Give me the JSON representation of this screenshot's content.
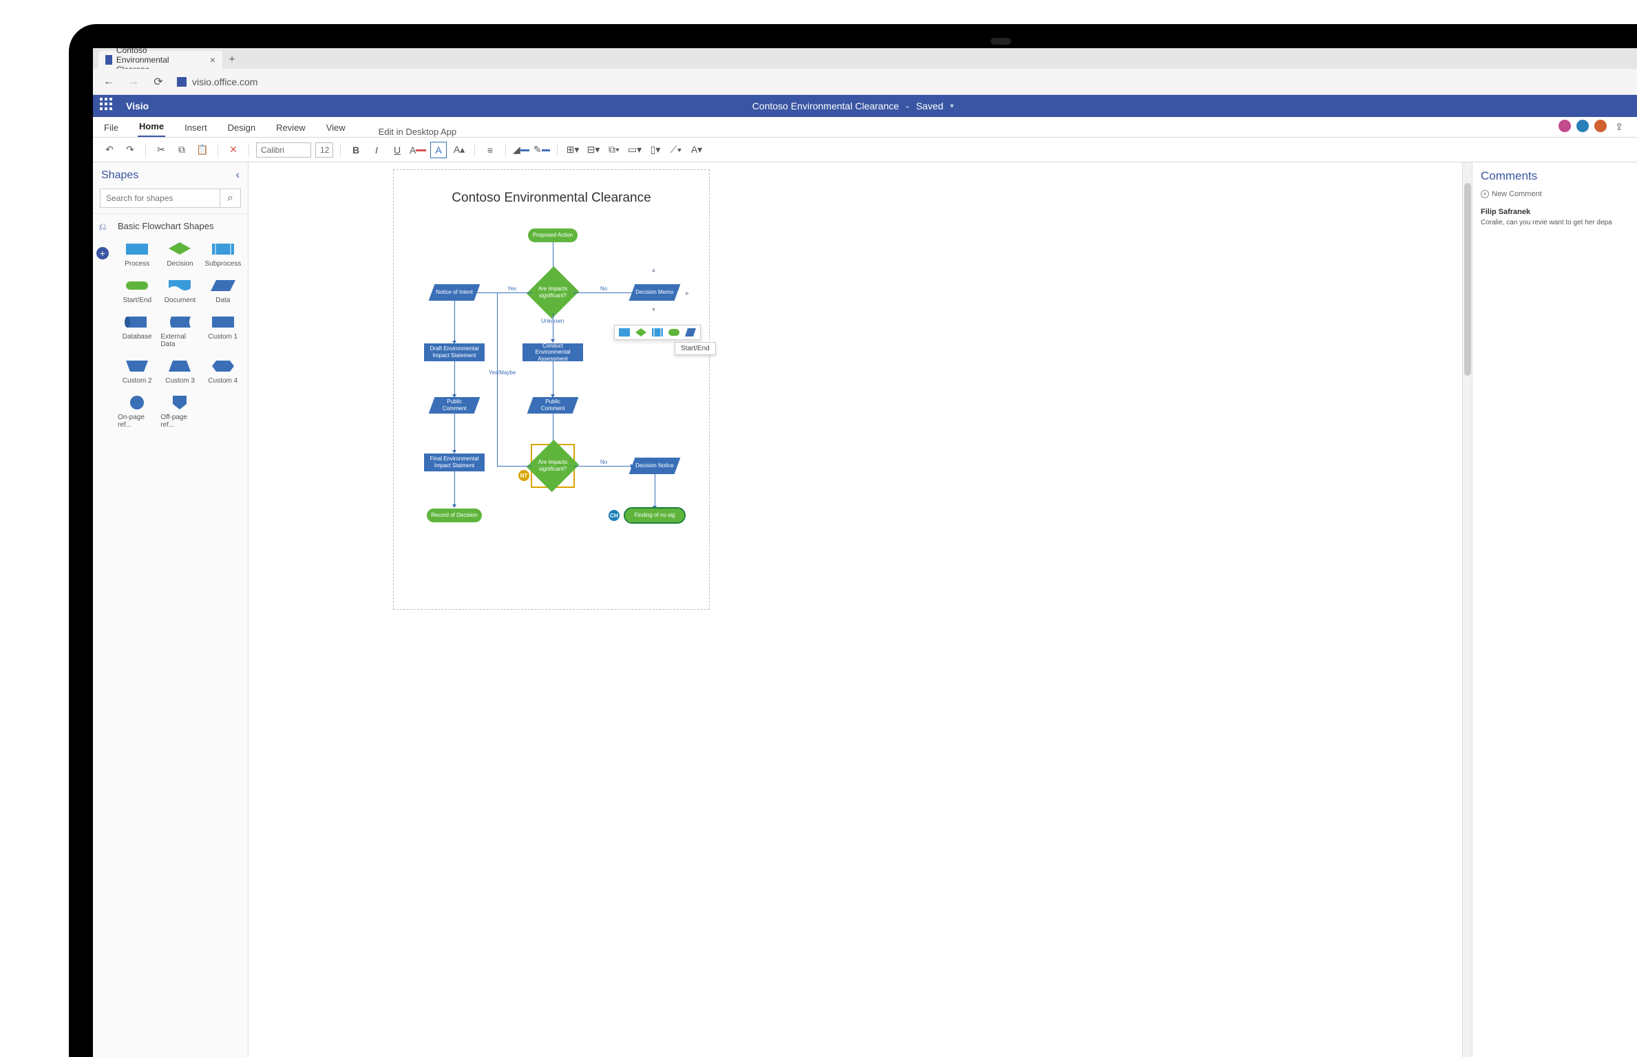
{
  "browser": {
    "tab_title": "Contoso Environmental Clearanc",
    "url": "visio.office.com"
  },
  "header": {
    "app_name": "Visio",
    "doc_name": "Contoso Environmental Clearance",
    "doc_status": "Saved"
  },
  "ribbon": {
    "tabs": [
      "File",
      "Home",
      "Insert",
      "Design",
      "Review",
      "View"
    ],
    "active_tab": "Home",
    "edit_desktop": "Edit in Desktop App",
    "font_name": "Calibri",
    "font_size": "12"
  },
  "avatars": [
    {
      "color": "#c34a8c"
    },
    {
      "color": "#2a7fb8"
    },
    {
      "color": "#d06030"
    }
  ],
  "shapes_panel": {
    "title": "Shapes",
    "search_placeholder": "Search for shapes",
    "stencil_title": "Basic Flowchart Shapes",
    "items": [
      {
        "label": "Process"
      },
      {
        "label": "Decision"
      },
      {
        "label": "Subprocess"
      },
      {
        "label": "Start/End"
      },
      {
        "label": "Document"
      },
      {
        "label": "Data"
      },
      {
        "label": "Database"
      },
      {
        "label": "External Data"
      },
      {
        "label": "Custom 1"
      },
      {
        "label": "Custom 2"
      },
      {
        "label": "Custom 3"
      },
      {
        "label": "Custom 4"
      },
      {
        "label": "On-page ref..."
      },
      {
        "label": "Off-page ref..."
      }
    ]
  },
  "canvas": {
    "title": "Contoso Environmental Clearance",
    "tooltip": "Start/End",
    "nodes": {
      "proposed_action": "Proposed Action",
      "notice_of_intent": "Notice of Intent",
      "impacts_q1": "Are impacts significant?",
      "decision_memo": "Decision Memo",
      "draft_eis": "Draft Environmental Impact Statement",
      "conduct_assessment": "Conduct Environmental Assessment",
      "public_comment_left": "Public Comment",
      "public_comment_right": "Public Comment",
      "final_eis": "Final Environmental Impact Statment",
      "impacts_q2": "Are impacts significant?",
      "decision_notice": "Decision Notice",
      "record_of_decision": "Record of Decision",
      "finding_no_sig": "Finding of no sig"
    },
    "edge_labels": {
      "yes": "Yes",
      "no1": "No",
      "unknown": "Unknown",
      "yes_maybe": "Yes/Maybe",
      "no2": "No"
    },
    "badges": {
      "nt": "NT",
      "ch": "CH"
    }
  },
  "comments": {
    "title": "Comments",
    "new_label": "New Comment",
    "thread": {
      "author": "Filip Safranek",
      "text": "Coralie, can you revie want to get her depa"
    }
  }
}
